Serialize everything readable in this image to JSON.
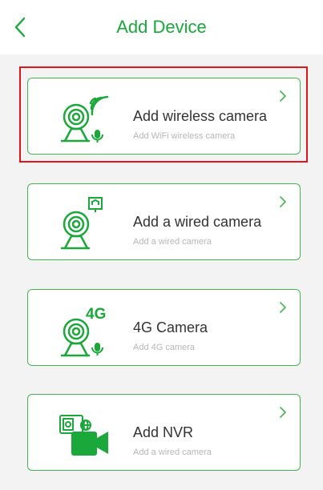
{
  "header": {
    "title": "Add Device",
    "back_icon": "chevron-left-icon"
  },
  "colors": {
    "accent": "#1aa83a",
    "card_border": "#44b84f",
    "highlight": "#e0161b",
    "background": "#f3f3f3"
  },
  "cards": [
    {
      "label": "Add wireless camera",
      "sublabel": "Add WiFi wireless camera",
      "icon": "wireless-camera-icon",
      "highlighted": true
    },
    {
      "label": "Add a wired camera",
      "sublabel": "Add a wired camera",
      "icon": "wired-camera-icon",
      "highlighted": false
    },
    {
      "label": "4G Camera",
      "sublabel": "Add 4G camera",
      "icon": "4g-camera-icon",
      "icon_text": "4G",
      "highlighted": false
    },
    {
      "label": "Add NVR",
      "sublabel": "Add a wired camera",
      "icon": "nvr-icon",
      "highlighted": false
    }
  ]
}
